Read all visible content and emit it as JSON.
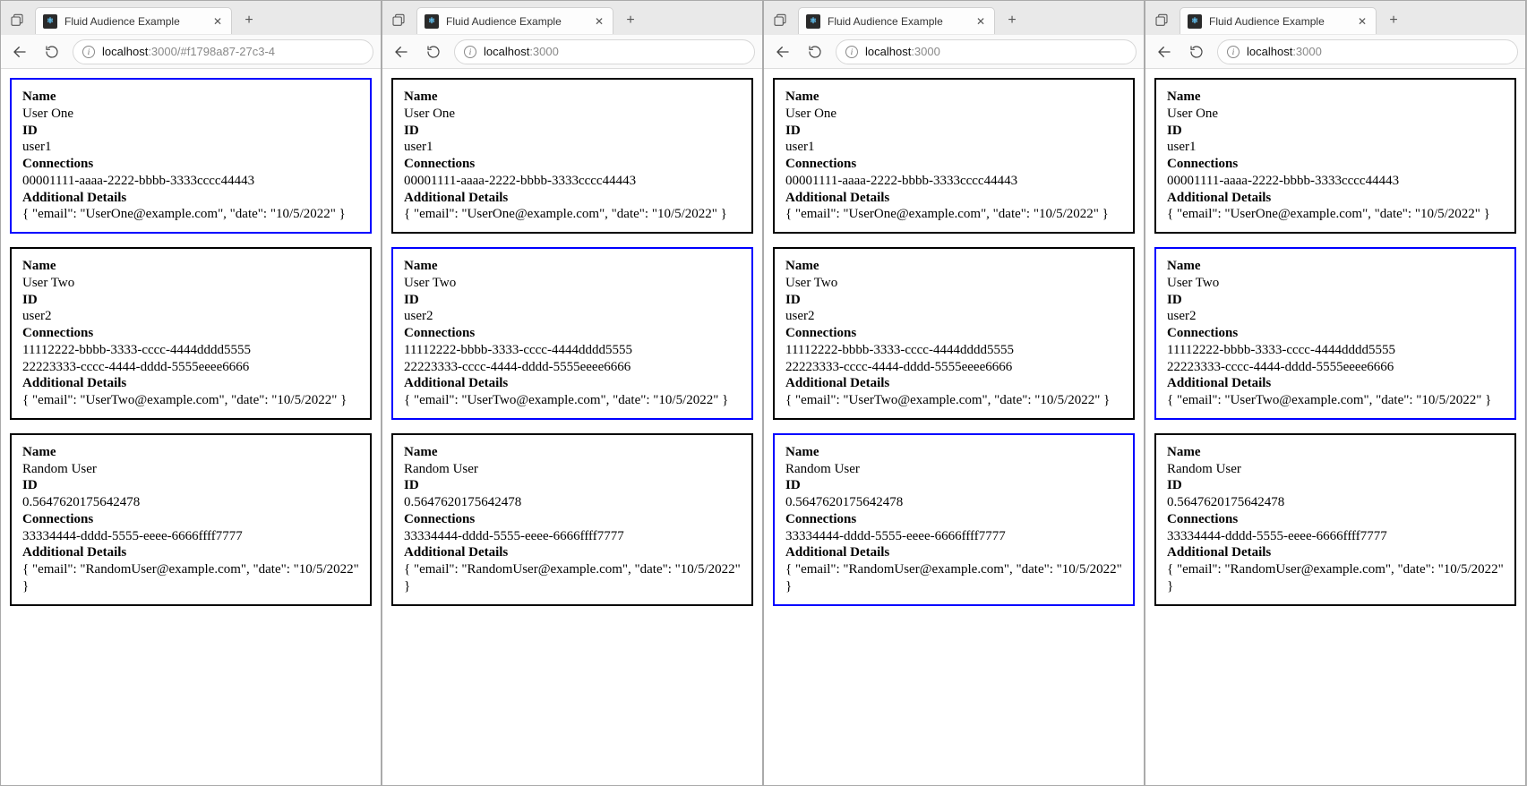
{
  "windows": [
    {
      "tab": {
        "title": "Fluid Audience Example"
      },
      "url": {
        "host": "localhost",
        "port": ":3000",
        "path": "/#f1798a87-27c3-4"
      },
      "selected_card_index": 0
    },
    {
      "tab": {
        "title": "Fluid Audience Example"
      },
      "url": {
        "host": "localhost",
        "port": ":3000",
        "path": ""
      },
      "selected_card_index": 1
    },
    {
      "tab": {
        "title": "Fluid Audience Example"
      },
      "url": {
        "host": "localhost",
        "port": ":3000",
        "path": ""
      },
      "selected_card_index": 2
    },
    {
      "tab": {
        "title": "Fluid Audience Example"
      },
      "url": {
        "host": "localhost",
        "port": ":3000",
        "path": ""
      },
      "selected_card_index": 1
    }
  ],
  "labels": {
    "name": "Name",
    "id": "ID",
    "connections": "Connections",
    "details": "Additional Details"
  },
  "cards": [
    {
      "name": "User One",
      "id": "user1",
      "connections": [
        "00001111-aaaa-2222-bbbb-3333cccc44443"
      ],
      "details": "{ \"email\": \"UserOne@example.com\", \"date\": \"10/5/2022\" }"
    },
    {
      "name": "User Two",
      "id": "user2",
      "connections": [
        "11112222-bbbb-3333-cccc-4444dddd5555",
        "22223333-cccc-4444-dddd-5555eeee6666"
      ],
      "details": "{ \"email\": \"UserTwo@example.com\", \"date\": \"10/5/2022\" }"
    },
    {
      "name": "Random User",
      "id": "0.5647620175642478",
      "connections": [
        "33334444-dddd-5555-eeee-6666ffff7777"
      ],
      "details": "{ \"email\": \"RandomUser@example.com\", \"date\": \"10/5/2022\" }"
    }
  ]
}
